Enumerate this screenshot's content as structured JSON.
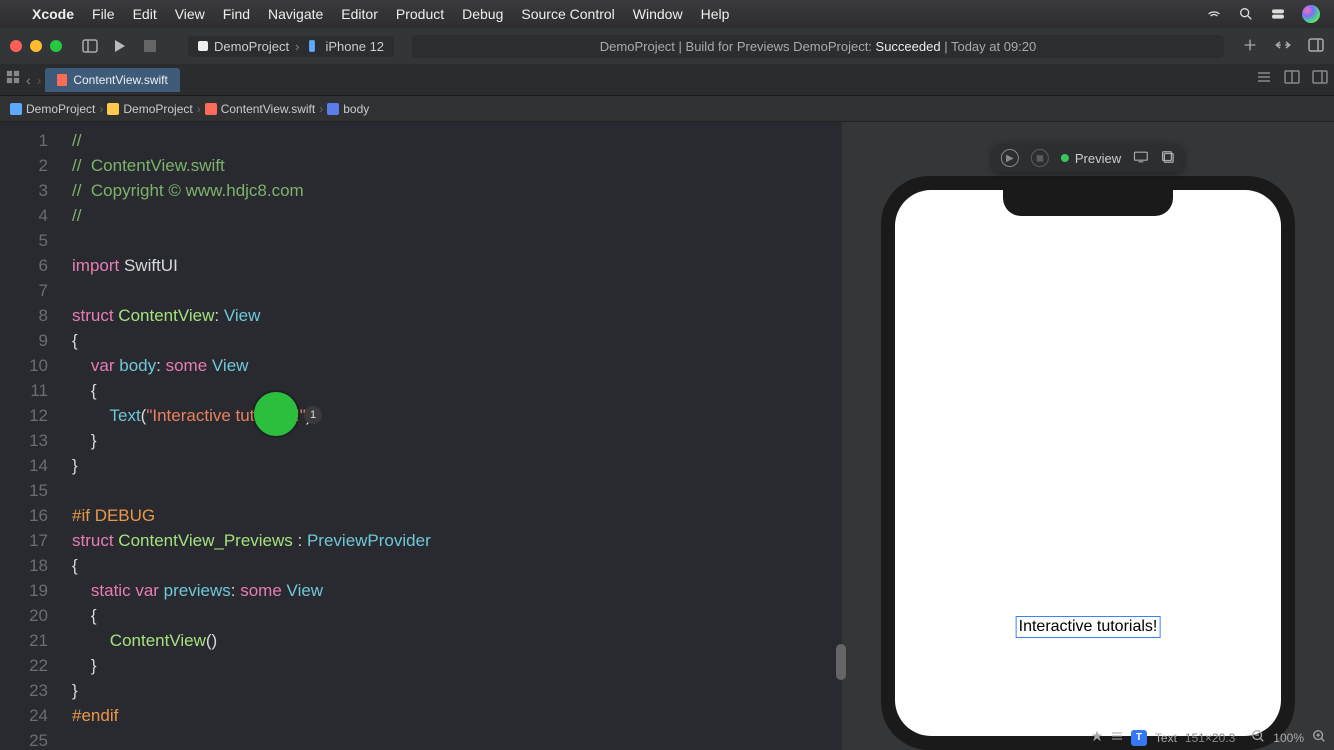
{
  "menubar": {
    "app": "Xcode",
    "items": [
      "File",
      "Edit",
      "View",
      "Find",
      "Navigate",
      "Editor",
      "Product",
      "Debug",
      "Source Control",
      "Window",
      "Help"
    ]
  },
  "toolbar": {
    "scheme_project": "DemoProject",
    "scheme_device": "iPhone 12",
    "status_prefix": "DemoProject | Build for Previews DemoProject: ",
    "status_result": "Succeeded",
    "status_time": " | Today at 09:20"
  },
  "tab": {
    "filename": "ContentView.swift"
  },
  "breadcrumb": {
    "project": "DemoProject",
    "folder": "DemoProject",
    "file": "ContentView.swift",
    "symbol": "body"
  },
  "code": {
    "comment_line1": "//",
    "comment_line2": "//  ContentView.swift",
    "comment_line3": "//  Copyright © www.hdjc8.com",
    "comment_line4": "//",
    "import_kw": "import",
    "import_mod": " SwiftUI",
    "struct_kw": "struct",
    "struct_name": " ContentView",
    "colon_view": ": ",
    "view_type": "View",
    "var_kw": "var",
    "body_name": " body",
    "body_sig": ": ",
    "some_kw": "some",
    "text_fn": "Text",
    "text_open": "(",
    "text_str": "\"Interactive tutorials!\"",
    "text_close": ")",
    "ifdebug": "#if",
    "debug_kw": " DEBUG",
    "previews_struct": " ContentView_Previews ",
    "previews_colon": ": ",
    "previews_type": "PreviewProvider",
    "static_kw": "static",
    "previews_var": " previews",
    "cv_call": "ContentView",
    "endif": "#endif",
    "brace_open": "{",
    "brace_close": "}",
    "paren_pair": "()"
  },
  "line_numbers": [
    "1",
    "2",
    "3",
    "4",
    "5",
    "6",
    "7",
    "8",
    "9",
    "10",
    "11",
    "12",
    "13",
    "14",
    "15",
    "16",
    "17",
    "18",
    "19",
    "20",
    "21",
    "22",
    "23",
    "24",
    "25"
  ],
  "preview": {
    "label": "Preview",
    "screen_text": "Interactive tutorials!",
    "inspector_label": "Text",
    "inspector_size": "151×20.3",
    "zoom": "100%"
  },
  "badge": "1"
}
